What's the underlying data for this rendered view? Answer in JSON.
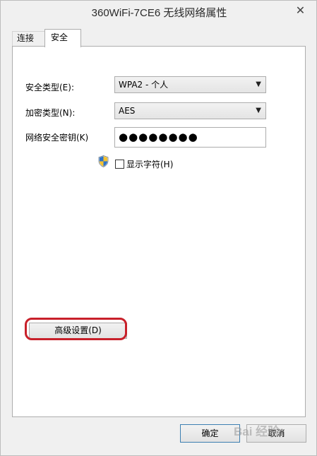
{
  "window": {
    "title": "360WiFi-7CE6 无线网络属性",
    "close_symbol": "✕"
  },
  "tabs": [
    {
      "label": "连接",
      "active": false
    },
    {
      "label": "安全",
      "active": true
    }
  ],
  "security": {
    "security_type_label": "安全类型(E):",
    "security_type_value": "WPA2 - 个人",
    "encryption_type_label": "加密类型(N):",
    "encryption_type_value": "AES",
    "network_key_label": "网络安全密钥(K)",
    "network_key_value": "●●●●●●●●",
    "show_characters_label": "显示字符(H)",
    "show_characters_checked": false,
    "shield_icon": "uac-shield-icon",
    "dropdown_arrow": "▼"
  },
  "advanced_button_label": "高级设置(D)",
  "footer": {
    "ok_label": "确定",
    "cancel_label": "取消"
  },
  "watermark": "Bai 经验",
  "colors": {
    "highlight": "#c8202a",
    "panel_bg": "#ffffff",
    "window_bg": "#f0f0f0"
  }
}
